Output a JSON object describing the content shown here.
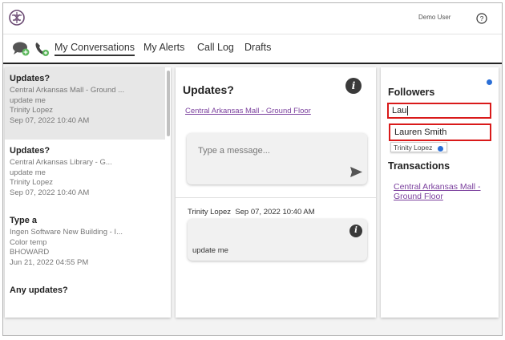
{
  "header": {
    "user_name": "Demo User"
  },
  "nav": {
    "tabs": [
      {
        "label": "My Conversations",
        "active": true
      },
      {
        "label": "My Alerts",
        "active": false
      },
      {
        "label": "Call Log",
        "active": false
      },
      {
        "label": "Drafts",
        "active": false
      }
    ]
  },
  "conversations": [
    {
      "title": "Updates?",
      "location": "Central Arkansas Mall - Ground ...",
      "message": "update me",
      "author": "Trinity Lopez",
      "date": "Sep 07, 2022 10:40 AM",
      "selected": true
    },
    {
      "title": "Updates?",
      "location": "Central Arkansas Library - G...",
      "message": "update me",
      "author": "Trinity Lopez",
      "date": "Sep 07, 2022 10:40 AM",
      "selected": false
    },
    {
      "title": "Type a",
      "location": "Ingen Software New Building - I...",
      "message": "Color temp",
      "author": "BHOWARD",
      "date": "Jun 21, 2022 04:55 PM",
      "selected": false
    },
    {
      "title": "Any updates?",
      "location": "",
      "message": "",
      "author": "",
      "date": "",
      "selected": false
    }
  ],
  "detail": {
    "title": "Updates?",
    "link": "Central Arkansas Mall - Ground Floor",
    "compose_placeholder": "Type a message...",
    "messages": [
      {
        "author": "Trinity Lopez",
        "date": "Sep 07, 2022 10:40 AM",
        "text": "update me"
      }
    ]
  },
  "followers": {
    "heading": "Followers",
    "search_value": "Lau",
    "suggestion": "Lauren Smith",
    "chips": [
      "Trinity Lopez"
    ]
  },
  "transactions": {
    "heading": "Transactions",
    "items": [
      "Central Arkansas Mall - Ground Floor"
    ]
  },
  "colors": {
    "link": "#7a3f9d",
    "highlight": "#d91a1a",
    "chip_close": "#2b6fd6",
    "selected_row": "#e7e7e7"
  }
}
